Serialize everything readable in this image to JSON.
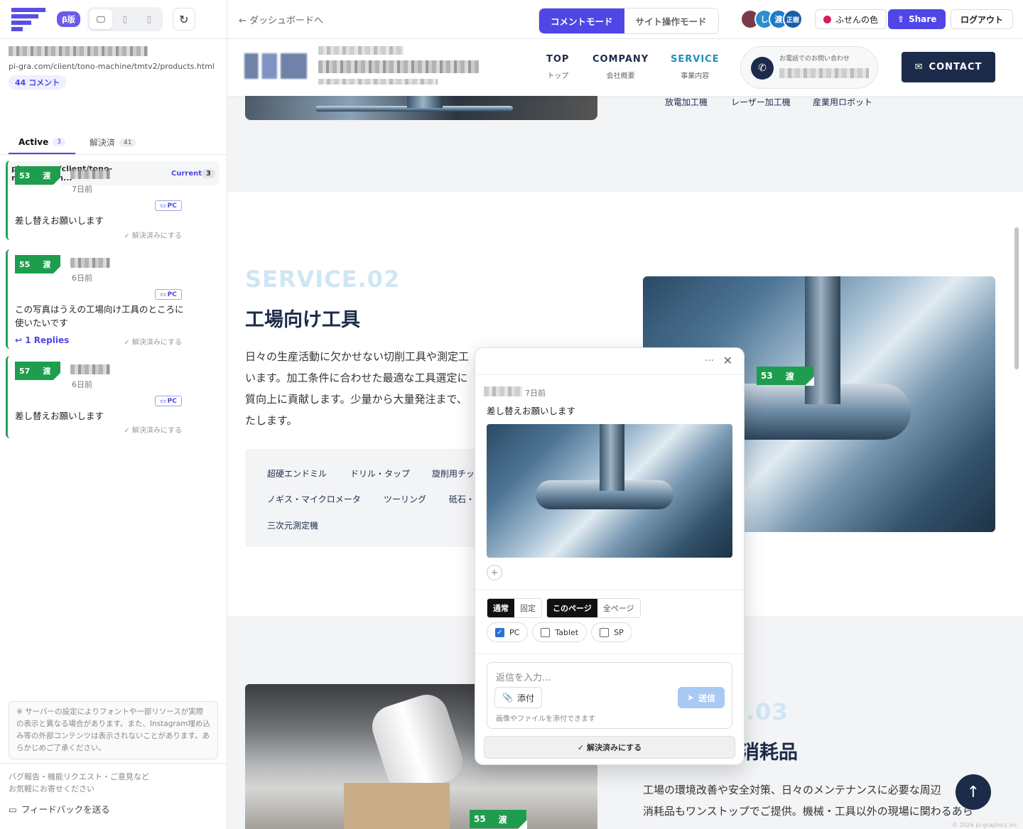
{
  "sidebar": {
    "beta": "β版",
    "page_url": "pi-gra.com/client/tono-machine/tmtv2/products.html",
    "comment_count": "44 コメント",
    "tabs": [
      {
        "label": "Active",
        "count": "3"
      },
      {
        "label": "解決済",
        "count": "41"
      }
    ],
    "page_header": {
      "url": "pi-gra.com/client/tono-machine/tm...",
      "current": "Current",
      "count": "3"
    },
    "comments": [
      {
        "num": "53",
        "status": "渡",
        "time": "7日前",
        "device": "PC",
        "text": "差し替えお願いします",
        "resolve": "✓ 解決済みにする"
      },
      {
        "num": "55",
        "status": "渡",
        "time": "6日前",
        "device": "PC",
        "text": "この写真はうえの工場向け工具のところに使いたいです",
        "replies": "1 Replies",
        "resolve": "✓ 解決済みにする"
      },
      {
        "num": "57",
        "status": "渡",
        "time": "6日前",
        "device": "PC",
        "text": "差し替えお願いします",
        "resolve": "✓ 解決済みにする"
      }
    ],
    "notice": "※ サーバーの設定によりフォントや一部リソースが実際の表示と異なる場合があります。また、Instagram埋め込み等の外部コンテンツは表示されないことがあります。あらかじめご了承ください。",
    "footer_text": "バグ報告・機能リクエスト・ご意見など お気軽にお寄せください",
    "feedback": "フィードバックを送る"
  },
  "header": {
    "back": "← ダッシュボードへ",
    "modes": [
      "コメントモード",
      "サイト操作モード"
    ],
    "avatars": [
      {
        "label": "",
        "color": "#7a3a4a"
      },
      {
        "label": "し",
        "color": "#2a8fd0"
      },
      {
        "label": "渡",
        "color": "#1f7bc4"
      },
      {
        "label": "正樹",
        "color": "#1a5ea8"
      }
    ],
    "sticky_color": "ふせんの色",
    "share": "Share",
    "logout": "ログアウト"
  },
  "site": {
    "nav": [
      {
        "en": "TOP",
        "ja": "トップ"
      },
      {
        "en": "COMPANY",
        "ja": "会社概要"
      },
      {
        "en": "SERVICE",
        "ja": "事業内容"
      }
    ],
    "phone_label": "お電話でのお問い合わせ",
    "contact": "CONTACT",
    "sub_links": [
      "放電加工機",
      "レーザー加工機",
      "産業用ロボット"
    ],
    "service02": {
      "tag": "SERVICE.02",
      "title": "工場向け工具",
      "lines": [
        "日々の生産活動に欠かせない切削工具や測定工",
        "います。加工条件に合わせた最適な工具選定に",
        "質向上に貢献します。少量から大量発注まで、",
        "たします。"
      ]
    },
    "chips": [
      "超硬エンドミル",
      "ドリル・タップ",
      "旋削用チッ",
      "ノギス・マイクロメータ",
      "ツーリング",
      "砥石・",
      "三次元測定機"
    ],
    "service03": {
      "tag": ".03",
      "title": "消耗品",
      "lines": [
        "工場の環境改善や安全対策、日々のメンテナンスに必要な周辺",
        "消耗品もワンストップでご提供。機械・工具以外の現場に関わるあら"
      ]
    },
    "pins": [
      {
        "num": "53",
        "status": "渡"
      },
      {
        "num": "55",
        "status": "渡"
      }
    ],
    "copyright": "© 2026 pi-graphics.inc"
  },
  "popup": {
    "time": "7日前",
    "text": "差し替えお願いします",
    "mode_toggle": [
      "通常",
      "固定"
    ],
    "scope_toggle": [
      "このページ",
      "全ページ"
    ],
    "devices": [
      {
        "label": "PC",
        "checked": true
      },
      {
        "label": "Tablet",
        "checked": false
      },
      {
        "label": "SP",
        "checked": false
      }
    ],
    "reply_placeholder": "返信を入力...",
    "attach": "添付",
    "send": "送信",
    "hint": "画像やファイルを添付できます",
    "resolve": "✓ 解決済みにする"
  },
  "colors": {
    "accent": "#4f46e5",
    "pin_green": "#1f9d4e",
    "navy": "#1d2b4a",
    "service_blue": "#1e90b8"
  }
}
